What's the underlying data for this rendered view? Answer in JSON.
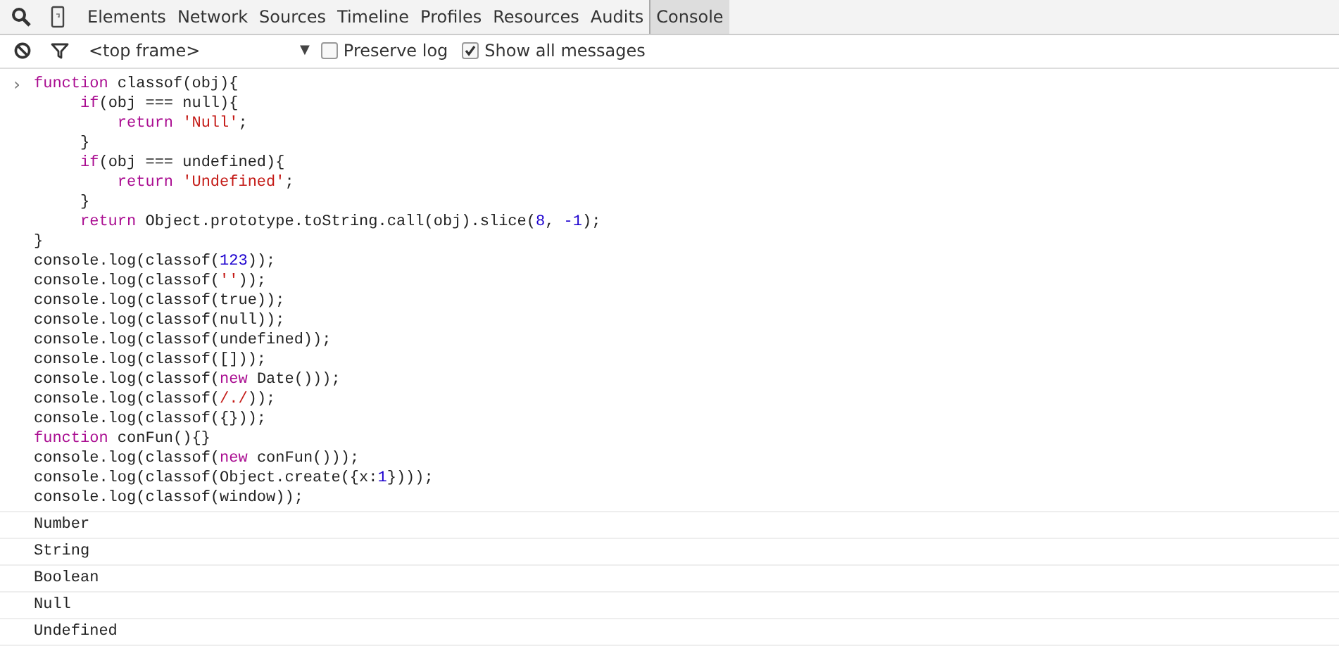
{
  "tabs": [
    {
      "label": "Elements",
      "selected": false
    },
    {
      "label": "Network",
      "selected": false
    },
    {
      "label": "Sources",
      "selected": false
    },
    {
      "label": "Timeline",
      "selected": false
    },
    {
      "label": "Profiles",
      "selected": false
    },
    {
      "label": "Resources",
      "selected": false
    },
    {
      "label": "Audits",
      "selected": false
    },
    {
      "label": "Console",
      "selected": true
    }
  ],
  "filter_bar": {
    "context": "<top frame>",
    "dropdown_arrow": "▼",
    "options": [
      {
        "label": "Preserve log",
        "checked": false
      },
      {
        "label": "Show all messages",
        "checked": true
      }
    ]
  },
  "input": {
    "prompt": "›",
    "lines": [
      [
        {
          "kind": "keyword",
          "text": "function"
        },
        {
          "kind": "plain",
          "text": " classof(obj){"
        }
      ],
      [
        {
          "kind": "keyword",
          "text": "     if"
        },
        {
          "kind": "plain",
          "text": "(obj === null){"
        }
      ],
      [
        {
          "kind": "keyword",
          "text": "         return "
        },
        {
          "kind": "string",
          "text": "'Null'"
        },
        {
          "kind": "plain",
          "text": ";"
        }
      ],
      [
        {
          "kind": "plain",
          "text": "     }"
        }
      ],
      [
        {
          "kind": "keyword",
          "text": "     if"
        },
        {
          "kind": "plain",
          "text": "(obj === undefined){"
        }
      ],
      [
        {
          "kind": "keyword",
          "text": "         return "
        },
        {
          "kind": "string",
          "text": "'Undefined'"
        },
        {
          "kind": "plain",
          "text": ";"
        }
      ],
      [
        {
          "kind": "plain",
          "text": "     }"
        }
      ],
      [
        {
          "kind": "keyword",
          "text": "     return"
        },
        {
          "kind": "plain",
          "text": " Object.prototype.toString.call(obj).slice("
        },
        {
          "kind": "number",
          "text": "8"
        },
        {
          "kind": "plain",
          "text": ", "
        },
        {
          "kind": "number",
          "text": "-1"
        },
        {
          "kind": "plain",
          "text": ");"
        }
      ],
      [
        {
          "kind": "plain",
          "text": "}"
        }
      ],
      [
        {
          "kind": "plain",
          "text": "console.log(classof("
        },
        {
          "kind": "number",
          "text": "123"
        },
        {
          "kind": "plain",
          "text": "));"
        }
      ],
      [
        {
          "kind": "plain",
          "text": "console.log(classof("
        },
        {
          "kind": "string",
          "text": "''"
        },
        {
          "kind": "plain",
          "text": "));"
        }
      ],
      [
        {
          "kind": "plain",
          "text": "console.log(classof(true));"
        }
      ],
      [
        {
          "kind": "plain",
          "text": "console.log(classof(null));"
        }
      ],
      [
        {
          "kind": "plain",
          "text": "console.log(classof(undefined));"
        }
      ],
      [
        {
          "kind": "plain",
          "text": "console.log(classof([]));"
        }
      ],
      [
        {
          "kind": "plain",
          "text": "console.log(classof("
        },
        {
          "kind": "keyword",
          "text": "new"
        },
        {
          "kind": "plain",
          "text": " Date()));"
        }
      ],
      [
        {
          "kind": "plain",
          "text": "console.log(classof("
        },
        {
          "kind": "string",
          "text": "/./"
        },
        {
          "kind": "plain",
          "text": "));"
        }
      ],
      [
        {
          "kind": "plain",
          "text": "console.log(classof({}));"
        }
      ],
      [
        {
          "kind": "keyword",
          "text": "function"
        },
        {
          "kind": "plain",
          "text": " conFun(){}"
        }
      ],
      [
        {
          "kind": "plain",
          "text": "console.log(classof("
        },
        {
          "kind": "keyword",
          "text": "new"
        },
        {
          "kind": "plain",
          "text": " conFun()));"
        }
      ],
      [
        {
          "kind": "plain",
          "text": "console.log(classof(Object.create({x:"
        },
        {
          "kind": "number",
          "text": "1"
        },
        {
          "kind": "plain",
          "text": "})));"
        }
      ],
      [
        {
          "kind": "plain",
          "text": "console.log(classof(window));"
        }
      ]
    ]
  },
  "output": [
    "Number",
    "String",
    "Boolean",
    "Null",
    "Undefined"
  ]
}
